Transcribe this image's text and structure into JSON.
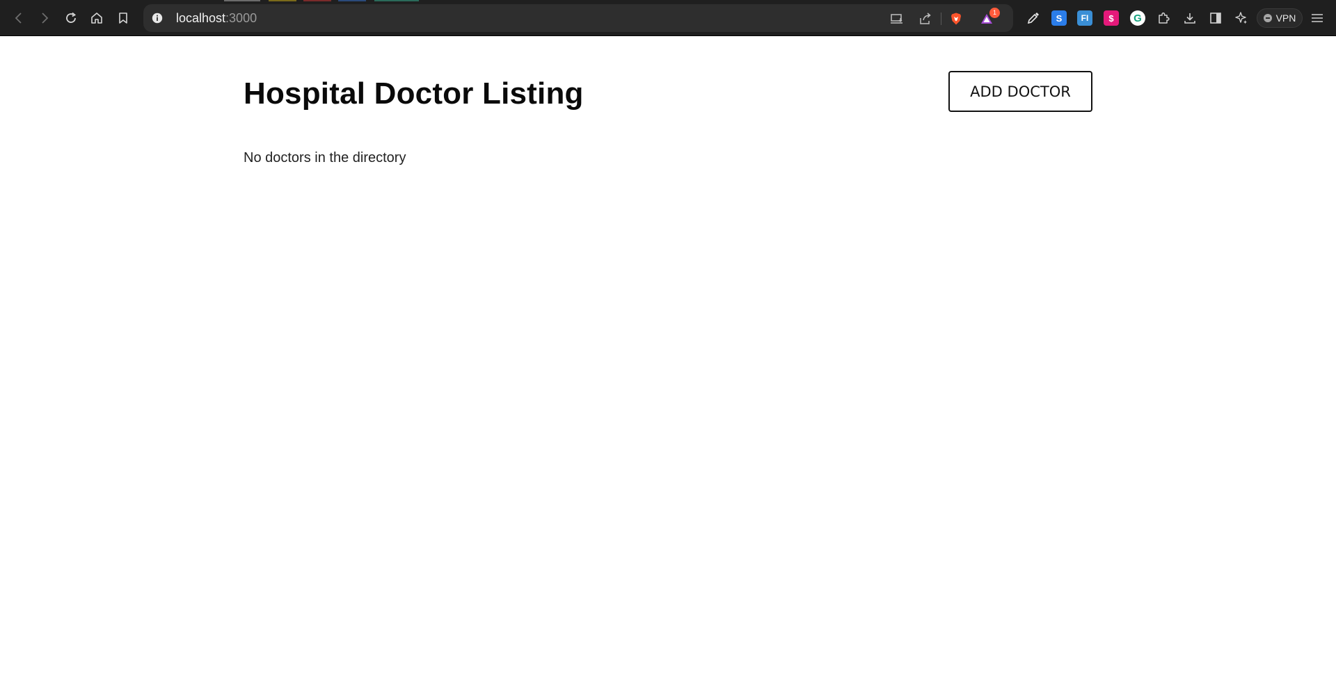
{
  "browser": {
    "url_host": "localhost",
    "url_port": ":3000",
    "notification_count": "1",
    "vpn_label": "VPN",
    "extensions": [
      {
        "icon": "eyedropper-icon"
      },
      {
        "icon": "s-extension-icon",
        "glyph": "S",
        "color": "#2b7de9"
      },
      {
        "icon": "fi-extension-icon",
        "glyph": "FI",
        "color": "#3a8fd6"
      },
      {
        "icon": "dollar-extension-icon",
        "glyph": "$",
        "color": "#e5197a"
      },
      {
        "icon": "grammarly-icon",
        "glyph": "G",
        "color": "#15c39a"
      }
    ]
  },
  "page": {
    "title": "Hospital Doctor Listing",
    "add_button_label": "ADD DOCTOR",
    "empty_message": "No doctors in the directory"
  }
}
